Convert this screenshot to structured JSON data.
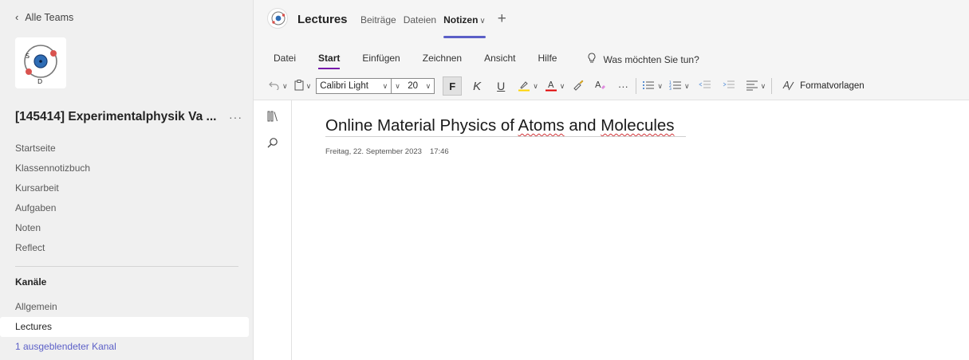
{
  "sidebar": {
    "back_label": "Alle Teams",
    "team_name": "[145414] Experimentalphysik Va ...",
    "more_label": "···",
    "nav_items": [
      "Startseite",
      "Klassennotizbuch",
      "Kursarbeit",
      "Aufgaben",
      "Noten",
      "Reflect"
    ],
    "channels_header": "Kanäle",
    "channels": [
      "Allgemein",
      "Lectures"
    ],
    "hidden_channels_link": "1 ausgeblendeter Kanal",
    "active_channel": "Lectures",
    "logo_letters": [
      "S",
      "D"
    ]
  },
  "header": {
    "channel_title": "Lectures",
    "tabs": [
      "Beiträge",
      "Dateien",
      "Notizen"
    ],
    "active_tab": "Notizen",
    "add_tab_label": "+"
  },
  "ribbon": {
    "menu_tabs": [
      "Datei",
      "Start",
      "Einfügen",
      "Zeichnen",
      "Ansicht",
      "Hilfe"
    ],
    "active_menu": "Start",
    "tell_me": "Was möchten Sie tun?",
    "font_name": "Calibri Light",
    "font_size": "20",
    "bold_label": "F",
    "italic_label": "K",
    "underline_label": "U",
    "more_label": "···",
    "styles_label": "Formatvorlagen"
  },
  "note": {
    "title_parts": [
      "Online Material Physics of ",
      "Atoms",
      " and ",
      "Molecules"
    ],
    "date": "Freitag, 22. September 2023",
    "time": "17:46"
  },
  "colors": {
    "accent": "#5b5fc7",
    "ribbon_accent": "#7719aa",
    "highlight": "#ffd400",
    "font_color": "#e00000"
  }
}
